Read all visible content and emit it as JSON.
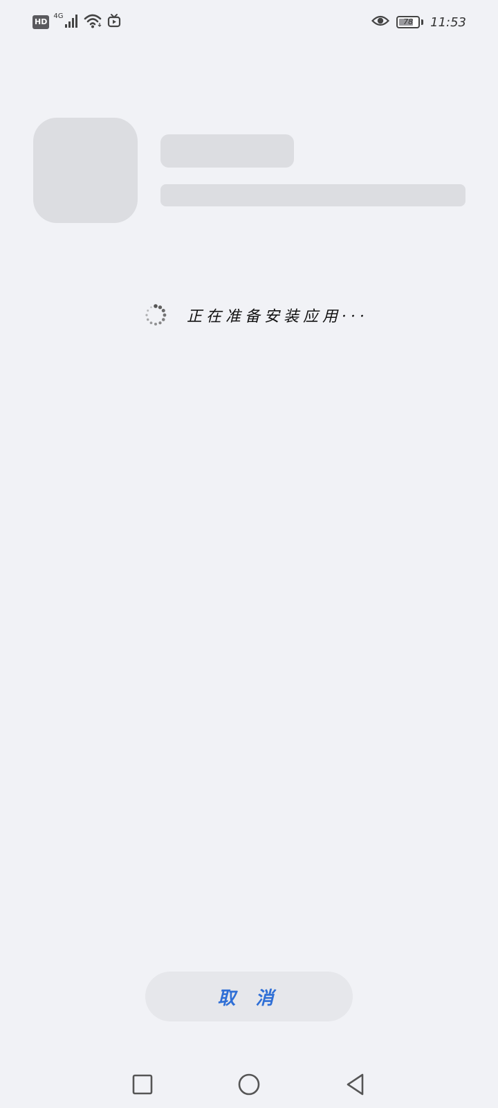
{
  "status_bar": {
    "hd_label": "HD",
    "network_type": "4G",
    "battery_level": 78,
    "battery_text": "78",
    "time": "11:53",
    "icons": [
      "hd-icon",
      "cellular-signal-icon",
      "wifi-icon",
      "tv-icon",
      "eye-icon",
      "battery-icon"
    ]
  },
  "install": {
    "status_text": "正在准备安装应用···"
  },
  "actions": {
    "cancel_label": "取 消"
  },
  "nav": {
    "icons": [
      "recents-square-icon",
      "home-circle-icon",
      "back-triangle-icon"
    ]
  },
  "colors": {
    "background": "#f1f2f6",
    "placeholder": "#dcdde1",
    "button_bg": "#e6e7eb",
    "accent": "#2f6fd6"
  }
}
